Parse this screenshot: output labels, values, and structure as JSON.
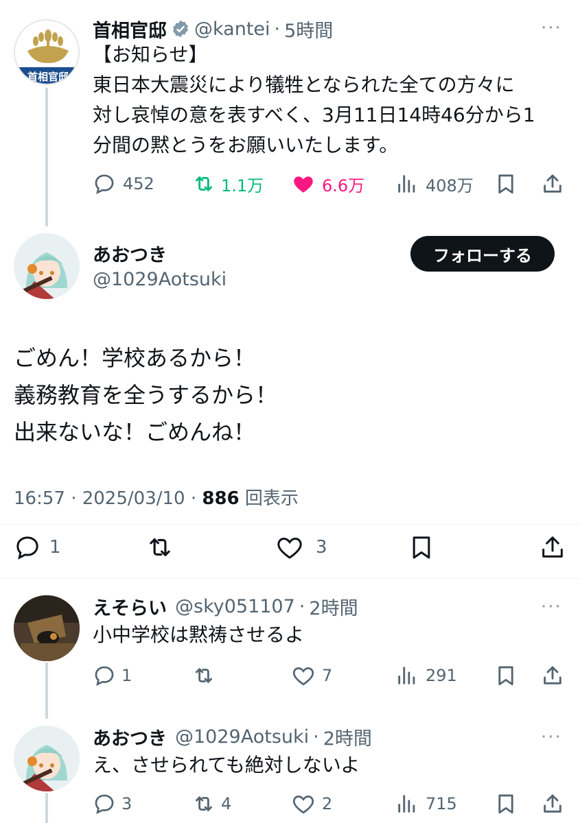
{
  "quoted": {
    "name": "首相官邸",
    "handle": "@kantei",
    "sep": "·",
    "time": "5時間",
    "more": "···",
    "avatar_text": "首相官邸",
    "lines": [
      "【お知らせ】",
      "東日本大震災により犠牲となられた全ての方々に",
      "対し哀悼の意を表すべく、3月11日14時46分から1",
      "分間の黙とうをお願いいたします。"
    ],
    "replies": "452",
    "retweets": "1.1万",
    "likes": "6.6万",
    "views": "408万"
  },
  "main": {
    "name": "あおつき",
    "handle": "@1029Aotsuki",
    "follow_label": "フォローする",
    "lines": [
      "ごめん！学校あるから！",
      "義務教育を全うするから！",
      "出来ないな！ごめんね！"
    ],
    "timestamp": "16:57 · 2025/03/10 · ",
    "view_count": "886",
    "view_label": " 回表示",
    "replies": "1",
    "likes": "3"
  },
  "reply1": {
    "name": "えそらい",
    "handle": "@sky051107",
    "sep": "·",
    "time": "2時間",
    "more": "···",
    "text": "小中学校は黙祷させるよ",
    "replies": "1",
    "likes": "7",
    "views": "291"
  },
  "reply2": {
    "name": "あおつき",
    "handle": "@1029Aotsuki",
    "sep": "·",
    "time": "2時間",
    "more": "···",
    "text": "え、させられても絶対しないよ",
    "replies": "3",
    "retweets": "4",
    "likes": "2",
    "views": "715"
  },
  "colors": {
    "text": "#0f1419",
    "secondary": "#536471",
    "verified": "#829aab",
    "retweet": "#00ba7c",
    "like": "#f91880",
    "follow_bg": "#0f1419"
  }
}
